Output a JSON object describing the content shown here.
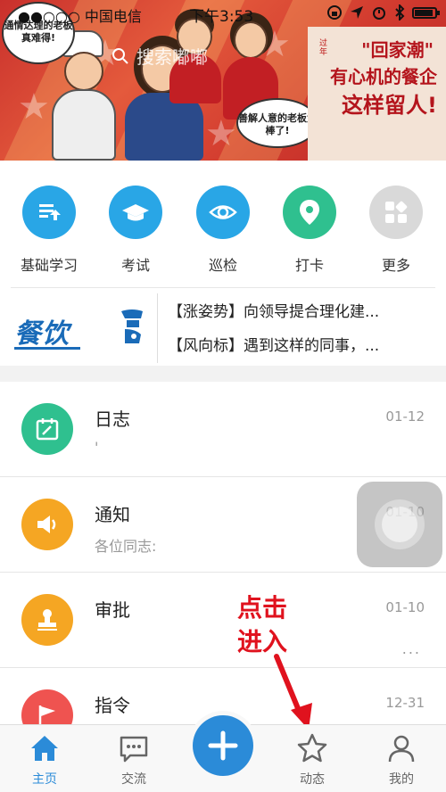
{
  "status_bar": {
    "carrier": "●●○○○ 中国电信",
    "time": "下午3:53"
  },
  "banner": {
    "search_placeholder": "搜索嘟嘟",
    "bubble_left": "通情达理的老板真难得!",
    "bubble_right": "善解人意的老板太棒了!",
    "promo_year": "过年",
    "promo_line1": "\"回家潮\"",
    "promo_line2": "有心机的餐企",
    "promo_line3": "这样留人!"
  },
  "quick_actions": [
    {
      "label": "基础学习",
      "icon": "book-upload-icon",
      "color": "#29a6e6"
    },
    {
      "label": "考试",
      "icon": "graduation-cap-icon",
      "color": "#29a6e6"
    },
    {
      "label": "巡检",
      "icon": "eye-icon",
      "color": "#29a6e6"
    },
    {
      "label": "打卡",
      "icon": "location-pin-icon",
      "color": "#2fc08f"
    },
    {
      "label": "更多",
      "icon": "grid-icon",
      "color": "#d9d9d9"
    }
  ],
  "news": {
    "logo": "餐饮",
    "items": [
      "【涨姿势】向领导提合理化建...",
      "【风向标】遇到这样的同事，..."
    ]
  },
  "messages": [
    {
      "title": "日志",
      "subtitle": "'",
      "date": "01-12",
      "icon": "calendar-edit-icon",
      "color": "#2fc08f"
    },
    {
      "title": "通知",
      "subtitle": "各位同志:",
      "date": "01-10",
      "icon": "speaker-icon",
      "color": "#f5a623"
    },
    {
      "title": "审批",
      "subtitle": "",
      "date": "01-10",
      "icon": "stamp-icon",
      "color": "#f5a623",
      "more": "..."
    },
    {
      "title": "指令",
      "subtitle": "",
      "date": "12-31",
      "icon": "flag-icon",
      "color": "#ef5350"
    }
  ],
  "annotation": {
    "line1": "点击",
    "line2": "进入"
  },
  "tabs": [
    {
      "label": "主页",
      "icon": "home-icon"
    },
    {
      "label": "交流",
      "icon": "chat-bubble-icon"
    },
    {
      "label": "",
      "icon": "plus-icon"
    },
    {
      "label": "动态",
      "icon": "star-icon"
    },
    {
      "label": "我的",
      "icon": "person-icon"
    }
  ],
  "colors": {
    "accent": "#2b8bd8",
    "annotation": "#e0121e"
  }
}
